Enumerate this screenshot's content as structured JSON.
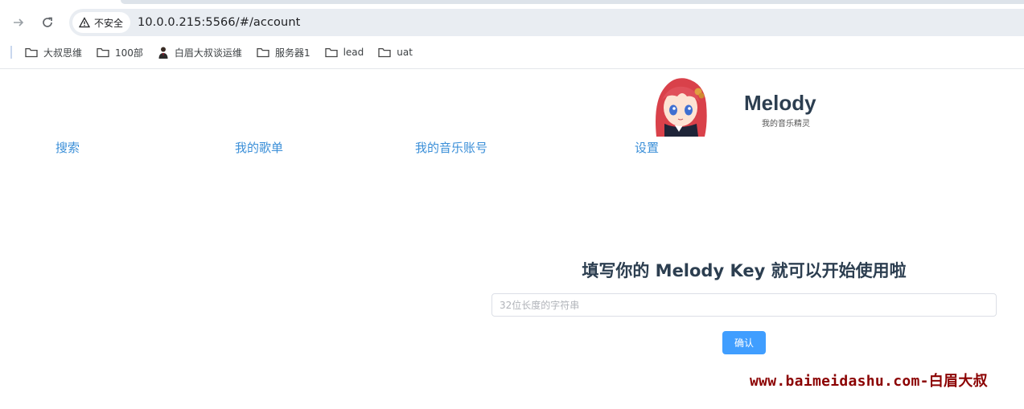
{
  "browser": {
    "security_label": "不安全",
    "url": "10.0.0.215:5566/#/account",
    "bookmarks": [
      {
        "label": "大叔思维",
        "icon": "folder-icon"
      },
      {
        "label": "100部",
        "icon": "folder-icon"
      },
      {
        "label": "白眉大叔谈运维",
        "icon": "person-favicon-icon"
      },
      {
        "label": "服务器1",
        "icon": "folder-icon"
      },
      {
        "label": "lead",
        "icon": "folder-icon"
      },
      {
        "label": "uat",
        "icon": "folder-icon"
      }
    ]
  },
  "app": {
    "title": "Melody",
    "subtitle": "我的音乐精灵",
    "logo_icon": "anime-girl-avatar",
    "nav": [
      {
        "label": "搜索"
      },
      {
        "label": "我的歌单"
      },
      {
        "label": "我的音乐账号"
      },
      {
        "label": "设置"
      }
    ]
  },
  "account": {
    "heading": "填写你的 Melody Key 就可以开始使用啦",
    "key_placeholder": "32位长度的字符串",
    "key_value": "",
    "confirm_label": "确认"
  },
  "watermark": "www.baimeidashu.com-白眉大叔",
  "colors": {
    "accent": "#409eff",
    "link": "#3b8fd8",
    "heading": "#2c3e50",
    "watermark": "#8b0000"
  }
}
